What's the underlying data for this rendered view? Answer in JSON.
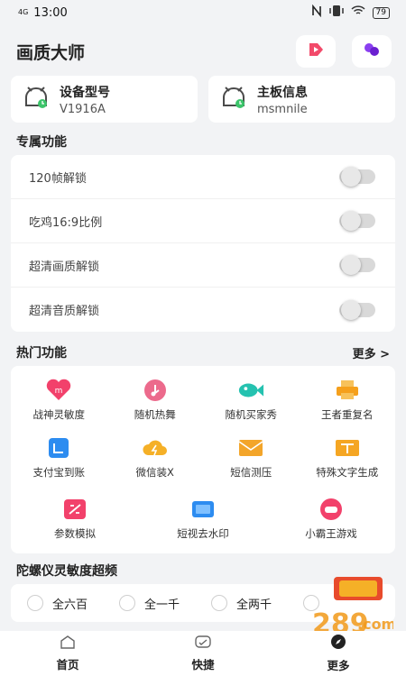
{
  "status_bar": {
    "signal": "4G",
    "time": "13:00",
    "battery": "79"
  },
  "header": {
    "title": "画质大师",
    "icons": [
      "video-play-icon",
      "purple-blob-icon"
    ]
  },
  "info_cards": [
    {
      "title": "设备型号",
      "value": "V1916A",
      "icon": "clock-robot-icon"
    },
    {
      "title": "主板信息",
      "value": "msmnile",
      "icon": "clock-robot-icon"
    }
  ],
  "exclusive": {
    "title": "专属功能",
    "toggles": [
      {
        "label": "120帧解锁",
        "on": false
      },
      {
        "label": "吃鸡16:9比例",
        "on": false
      },
      {
        "label": "超清画质解锁",
        "on": false
      },
      {
        "label": "超清音质解锁",
        "on": false
      }
    ]
  },
  "hot": {
    "title": "热门功能",
    "more": "更多 >",
    "items": [
      {
        "label": "战神灵敏度",
        "icon": "heart-m-icon",
        "color": "#f2416b"
      },
      {
        "label": "随机热舞",
        "icon": "music-disc-icon",
        "color": "#ec6a8c"
      },
      {
        "label": "随机买家秀",
        "icon": "fish-icon",
        "color": "#25c2b0"
      },
      {
        "label": "王者重复名",
        "icon": "printer-icon",
        "color": "#f5a01c"
      },
      {
        "label": "支付宝到账",
        "icon": "alipay-icon",
        "color": "#2d8cf0"
      },
      {
        "label": "微信装X",
        "icon": "cloud-bolt-icon",
        "color": "#f5b027"
      },
      {
        "label": "短信测压",
        "icon": "envelope-icon",
        "color": "#f3a52a"
      },
      {
        "label": "特殊文字生成",
        "icon": "text-gen-icon",
        "color": "#f5a623"
      }
    ],
    "items_row3": [
      {
        "label": "参数模拟",
        "icon": "sliders-icon",
        "color": "#f2416b"
      },
      {
        "label": "短视去水印",
        "icon": "watermark-icon",
        "color": "#2d8cf0"
      },
      {
        "label": "小霸王游戏",
        "icon": "gamepad-icon",
        "color": "#f2416b"
      }
    ]
  },
  "gyro": {
    "title": "陀螺仪灵敏度超频",
    "options": [
      "全六百",
      "全一千",
      "全两千"
    ]
  },
  "nav": [
    {
      "label": "首页",
      "icon": "home-icon"
    },
    {
      "label": "快捷",
      "icon": "shortcut-icon"
    },
    {
      "label": "更多",
      "icon": "compass-icon"
    }
  ]
}
